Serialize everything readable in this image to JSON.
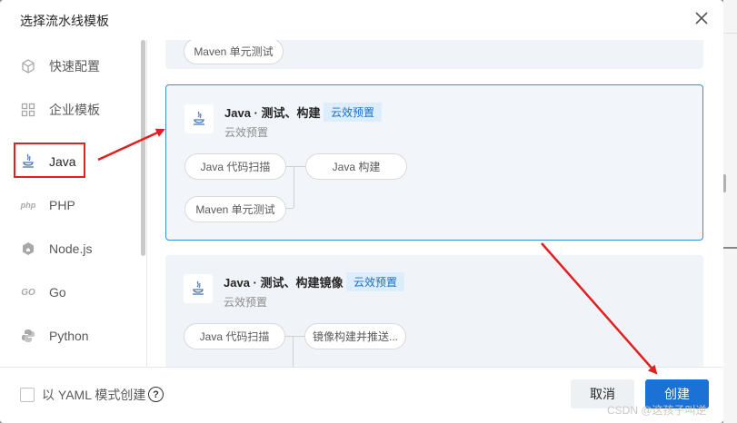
{
  "dialog": {
    "title": "选择流水线模板"
  },
  "sidebar": {
    "items": [
      {
        "label": "快速配置",
        "icon": "cube-icon"
      },
      {
        "label": "企业模板",
        "icon": "grid-icon"
      },
      {
        "label": "Java",
        "icon": "java-icon"
      },
      {
        "label": "PHP",
        "icon": "php-icon"
      },
      {
        "label": "Node.js",
        "icon": "nodejs-icon"
      },
      {
        "label": "Go",
        "icon": "go-icon"
      },
      {
        "label": "Python",
        "icon": "python-icon"
      }
    ],
    "active": "Java",
    "php_icon_text": "php",
    "go_icon_text": "GO"
  },
  "cards": [
    {
      "stages": [
        "Maven 单元测试"
      ]
    },
    {
      "title": "Java · 测试、构建",
      "badge": "云效预置",
      "subtitle": "云效预置",
      "stages": [
        "Java 代码扫描",
        "Java 构建",
        "Maven 单元测试"
      ],
      "selected": true
    },
    {
      "title": "Java · 测试、构建镜像",
      "badge": "云效预置",
      "subtitle": "云效预置",
      "stages": [
        "Java 代码扫描",
        "镜像构建并推送..."
      ]
    }
  ],
  "footer": {
    "yaml_label": "以 YAML 模式创建",
    "help_symbol": "?",
    "cancel_label": "取消",
    "create_label": "创建"
  },
  "watermark": "CSDN @这孩子叫逆",
  "colors": {
    "accent": "#1b72d4",
    "annotation_red": "#e02020",
    "badge_bg": "#dceefc"
  }
}
